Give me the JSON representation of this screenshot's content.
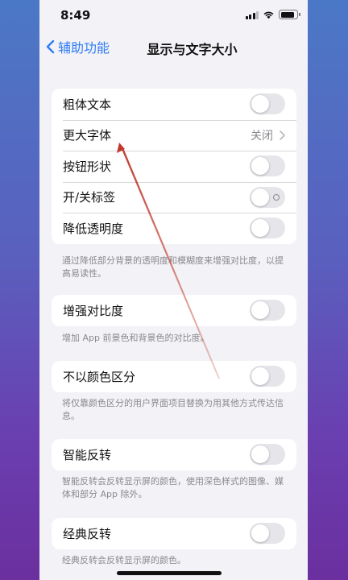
{
  "status_bar": {
    "time": "8:49",
    "battery_level": 0.85
  },
  "nav": {
    "back_label": "辅助功能",
    "title": "显示与文字大小"
  },
  "groups": [
    {
      "rows": [
        {
          "label": "粗体文本",
          "toggle": false
        },
        {
          "label": "更大字体",
          "value": "关闭"
        },
        {
          "label": "按钮形状",
          "toggle": false
        },
        {
          "label": "开/关标签",
          "toggle": false
        },
        {
          "label": "降低透明度",
          "toggle": false
        }
      ],
      "footnote": "通过降低部分背景的透明度和模糊度来增强对比度，以提高易读性。"
    },
    {
      "rows": [
        {
          "label": "增强对比度",
          "toggle": false
        }
      ],
      "footnote": "增加 App 前景色和背景色的对比度。"
    },
    {
      "rows": [
        {
          "label": "不以颜色区分",
          "toggle": false
        }
      ],
      "footnote": "将仅靠颜色区分的用户界面项目替换为用其他方式传达信息。"
    },
    {
      "rows": [
        {
          "label": "智能反转",
          "toggle": false
        }
      ],
      "footnote": "智能反转会反转显示屏的颜色，使用深色样式的图像、媒体和部分 App 除外。"
    },
    {
      "rows": [
        {
          "label": "经典反转",
          "toggle": false
        }
      ],
      "footnote": "经典反转会反转显示屏的颜色。"
    }
  ],
  "colors": {
    "accent": "#2f7cf6",
    "annotation_arrow": "#c0392b"
  }
}
